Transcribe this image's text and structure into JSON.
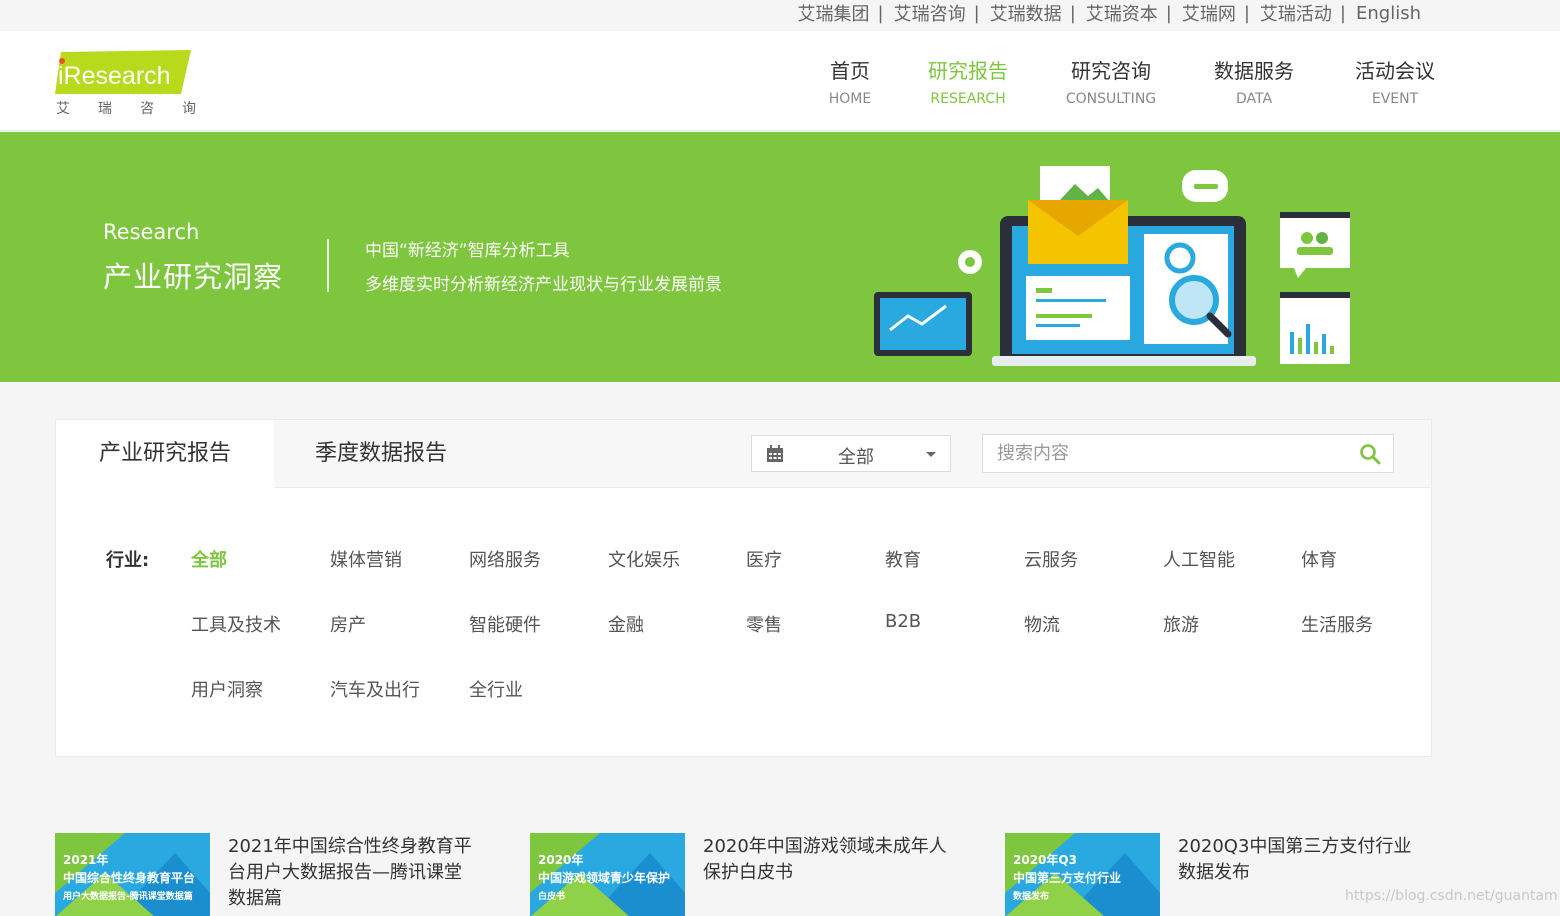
{
  "topbar": {
    "links": [
      "艾瑞集团",
      "艾瑞咨询",
      "艾瑞数据",
      "艾瑞资本",
      "艾瑞网",
      "艾瑞活动",
      "English"
    ],
    "separator": "|"
  },
  "logo": {
    "brand": "iResearch",
    "cn_chars": [
      "艾",
      "瑞",
      "咨",
      "询"
    ],
    "brand_color": "#b8d91c"
  },
  "nav": {
    "items": [
      {
        "zh": "首页",
        "en": "HOME",
        "active": false
      },
      {
        "zh": "研究报告",
        "en": "RESEARCH",
        "active": true
      },
      {
        "zh": "研究咨询",
        "en": "CONSULTING",
        "active": false
      },
      {
        "zh": "数据服务",
        "en": "DATA",
        "active": false
      },
      {
        "zh": "活动会议",
        "en": "EVENT",
        "active": false
      }
    ],
    "active_color": "#7dc63e"
  },
  "banner": {
    "eyebrow": "Research",
    "headline": "产业研究洞察",
    "line1": "中国“新经济”智库分析工具",
    "line2": "多维度实时分析新经济产业现状与行业发展前景",
    "bg_color": "#7dc63e"
  },
  "filters": {
    "tabs": [
      "产业研究报告",
      "季度数据报告"
    ],
    "active_tab": 0,
    "date_select": {
      "value": "全部"
    },
    "search": {
      "placeholder": "搜索内容",
      "value": ""
    },
    "industry_label": "行业:",
    "industries": [
      "全部",
      "媒体营销",
      "网络服务",
      "文化娱乐",
      "医疗",
      "教育",
      "云服务",
      "人工智能",
      "体育",
      "工具及技术",
      "房产",
      "智能硬件",
      "金融",
      "零售",
      "B2B",
      "物流",
      "旅游",
      "生活服务",
      "用户洞察",
      "汽车及出行",
      "全行业"
    ],
    "active_industry": 0
  },
  "reports": [
    {
      "thumb_year": "2021年",
      "thumb_main": "中国综合性终身教育平台",
      "thumb_sub": "用户大数据报告-腾讯课堂数据篇",
      "title": "2021年中国综合性终身教育平台用户大数据报告—腾讯课堂数据篇"
    },
    {
      "thumb_year": "2020年",
      "thumb_main": "中国游戏领域青少年保护",
      "thumb_sub": "白皮书",
      "title": "2020年中国游戏领域未成年人保护白皮书"
    },
    {
      "thumb_year": "2020年Q3",
      "thumb_main": "中国第三方支付行业",
      "thumb_sub": "数据发布",
      "title": "2020Q3中国第三方支付行业数据发布"
    }
  ],
  "watermark": "https://blog.csdn.net/guantam"
}
